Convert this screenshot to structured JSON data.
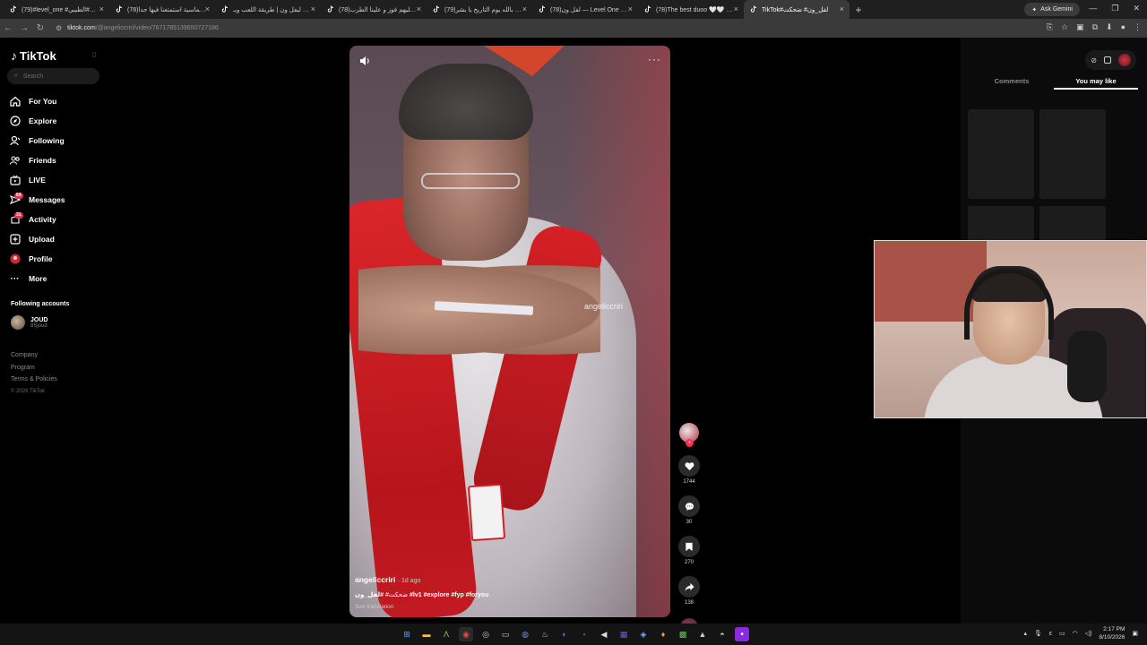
{
  "browser": {
    "tabs": [
      {
        "title": "(79)#level_one #لفل_ون#الطيبي",
        "active": false
      },
      {
        "title": "(78)ليلة حماسية استمتعنا فيها جدا",
        "active": false
      },
      {
        "title": "رايس ليفل ون | طريقة اللعب وبـ...",
        "active": false
      },
      {
        "title": "(78)هجا عليهم فوز و علينا الطرب",
        "active": false
      },
      {
        "title": "(79)اقسم بالله يوم التاريخ يا بشر",
        "active": false
      },
      {
        "title": "(78)لفل ون — Level One ثابتك",
        "active": false
      },
      {
        "title": "(78)The best duoo 🤍🤍 #ريلاو",
        "active": false
      },
      {
        "title": "TikTok#لفل_ون# ضحكت",
        "active": true
      }
    ],
    "gemini_label": "Ask Gemini",
    "url_host": "tiktok.com",
    "url_path": "/@angeliccriri/video/7671785139650727186"
  },
  "sidebar": {
    "logo": "TikTok",
    "search_placeholder": "Search",
    "items": [
      {
        "label": "For You",
        "icon": "home-icon"
      },
      {
        "label": "Explore",
        "icon": "compass-icon"
      },
      {
        "label": "Following",
        "icon": "following-icon"
      },
      {
        "label": "Friends",
        "icon": "friends-icon"
      },
      {
        "label": "LIVE",
        "icon": "live-icon"
      },
      {
        "label": "Messages",
        "icon": "messages-icon",
        "badge": "64"
      },
      {
        "label": "Activity",
        "icon": "activity-icon",
        "badge": "31"
      },
      {
        "label": "Upload",
        "icon": "upload-icon"
      },
      {
        "label": "Profile",
        "icon": "profile-icon"
      },
      {
        "label": "More",
        "icon": "more-icon"
      }
    ],
    "following_title": "Following accounts",
    "following": [
      {
        "name": "JOUD",
        "handle": "8Sjoud"
      }
    ],
    "footer": [
      "Company",
      "Program",
      "Terms & Policies"
    ],
    "copyright": "© 2026 TikTok"
  },
  "video": {
    "watermark": "angeliccriri",
    "author": "angeliccriri",
    "ago": "· 1d ago",
    "caption_text": "ضحكت#",
    "caption_tags": "#لفل_ون #lv1 #explore #fyp #foryou",
    "see_translation": "See translation"
  },
  "actions": {
    "likes": "1744",
    "comments": "30",
    "saves": "270",
    "shares": "138"
  },
  "right_panel": {
    "tabs": [
      "Comments",
      "You may like"
    ],
    "active_tab": "You may like"
  },
  "taskbar": {
    "time": "2:17 PM",
    "date": "8/10/2026"
  },
  "colors": {
    "accent": "#fe2c55",
    "background": "#000000"
  }
}
